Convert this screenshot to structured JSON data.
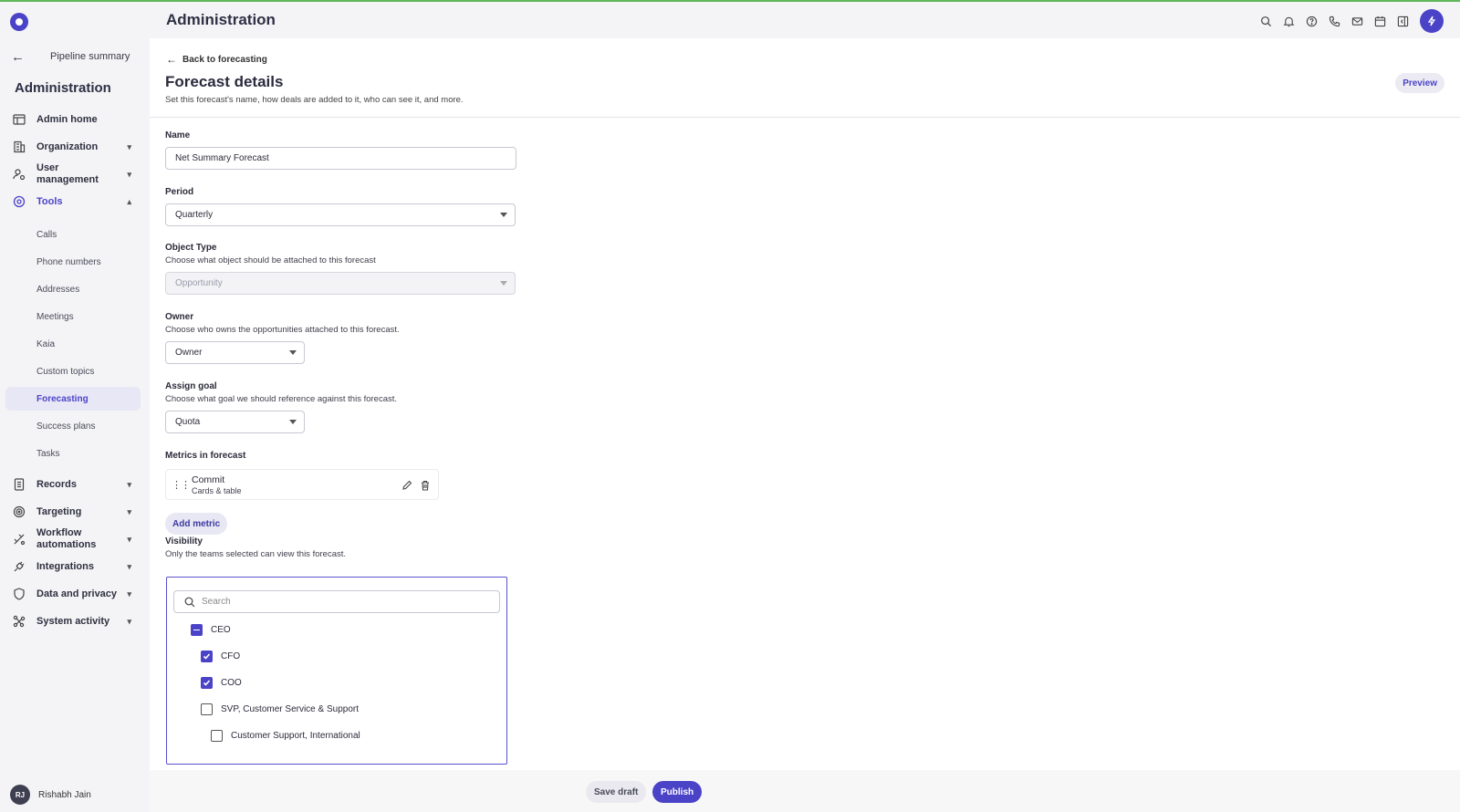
{
  "colors": {
    "accent": "#4b43c7",
    "stripe": "#5fb85a"
  },
  "header": {
    "title": "Administration"
  },
  "top_icons": [
    "search-icon",
    "bell-icon",
    "help-icon",
    "phone-icon",
    "mail-icon",
    "calendar-icon",
    "panel-icon",
    "bolt-icon"
  ],
  "sidebar": {
    "back_label": "Pipeline summary",
    "title": "Administration",
    "items": [
      {
        "label": "Admin home",
        "icon": "table-icon"
      },
      {
        "label": "Organization",
        "icon": "building-icon"
      },
      {
        "label": "User management",
        "icon": "user-gear-icon"
      },
      {
        "label": "Tools",
        "icon": "tools-icon"
      },
      {
        "label": "Records",
        "icon": "records-icon"
      },
      {
        "label": "Targeting",
        "icon": "target-icon"
      },
      {
        "label": "Workflow automations",
        "icon": "workflow-icon"
      },
      {
        "label": "Integrations",
        "icon": "plug-icon"
      },
      {
        "label": "Data and privacy",
        "icon": "shield-icon"
      },
      {
        "label": "System activity",
        "icon": "activity-icon"
      }
    ],
    "tools_subitems": [
      "Calls",
      "Phone numbers",
      "Addresses",
      "Meetings",
      "Kaia",
      "Custom topics",
      "Forecasting",
      "Success plans",
      "Tasks"
    ],
    "user": {
      "initials": "RJ",
      "name": "Rishabh Jain"
    }
  },
  "main": {
    "back_label": "Back to forecasting",
    "title": "Forecast details",
    "subtitle": "Set this forecast's name, how deals are added to it, who can see it, and more.",
    "preview_label": "Preview",
    "name": {
      "label": "Name",
      "value": "Net Summary Forecast"
    },
    "period": {
      "label": "Period",
      "value": "Quarterly"
    },
    "object_type": {
      "label": "Object Type",
      "help": "Choose what object should be attached to this forecast",
      "value": "Opportunity"
    },
    "owner": {
      "label": "Owner",
      "help": "Choose who owns the opportunities attached to this forecast.",
      "value": "Owner"
    },
    "goal": {
      "label": "Assign goal",
      "help": "Choose what goal we should reference against this forecast.",
      "value": "Quota"
    },
    "metrics": {
      "label": "Metrics in forecast",
      "items": [
        {
          "name": "Commit",
          "sub": "Cards & table"
        }
      ],
      "add_label": "Add metric"
    },
    "visibility": {
      "label": "Visibility",
      "help": "Only the teams selected can view this forecast.",
      "search_placeholder": "Search",
      "tree": [
        {
          "label": "CEO",
          "state": "partial"
        },
        {
          "label": "CFO",
          "state": "checked"
        },
        {
          "label": "COO",
          "state": "checked"
        },
        {
          "label": "SVP, Customer Service & Support",
          "state": "unchecked"
        },
        {
          "label": "Customer Support, International",
          "state": "unchecked"
        }
      ]
    }
  },
  "footer": {
    "save_draft": "Save draft",
    "publish": "Publish"
  }
}
